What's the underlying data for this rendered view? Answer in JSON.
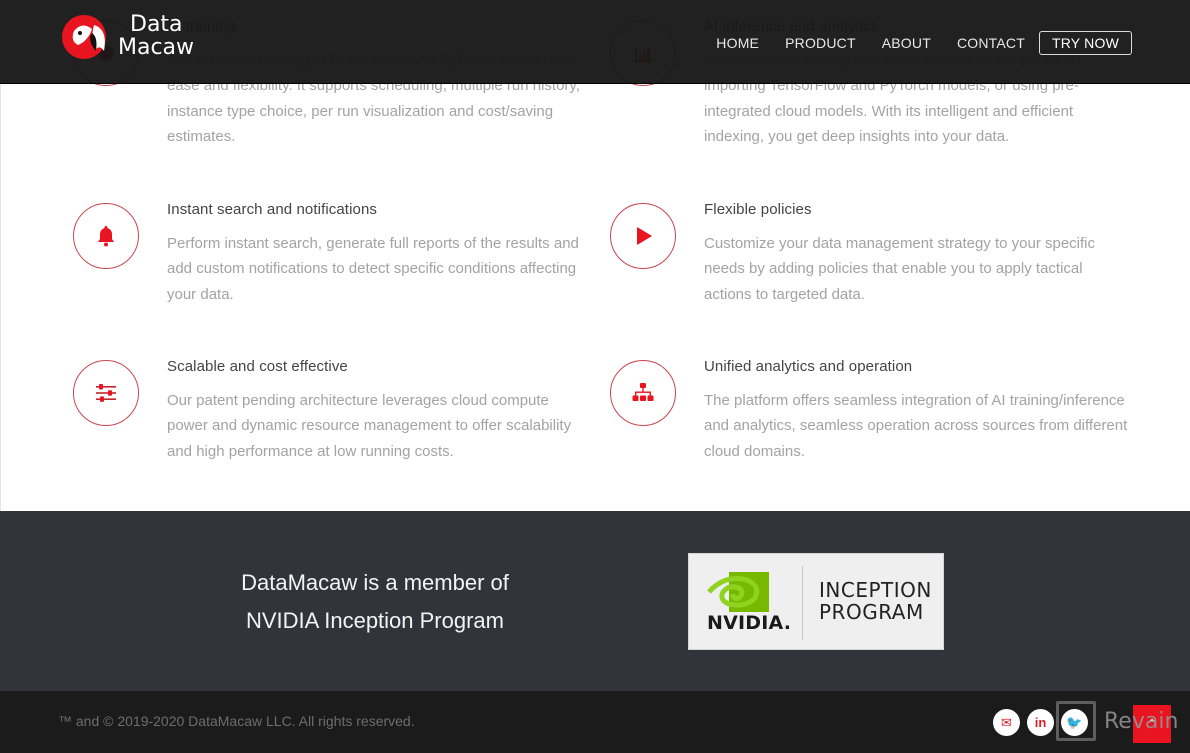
{
  "header": {
    "logo": {
      "line1": "Data",
      "line2": "Macaw"
    },
    "nav": [
      {
        "label": "HOME"
      },
      {
        "label": "PRODUCT"
      },
      {
        "label": "ABOUT"
      },
      {
        "label": "CONTACT"
      },
      {
        "label": "TRY NOW"
      }
    ]
  },
  "features": [
    {
      "title": "AI training",
      "description": "Scarlet offers training of TensorFlow and PyTorch models with ease and flexibility. It supports scheduling, multiple run history, instance type choice, per run visualization and cost/saving estimates.",
      "icon": "brain-icon"
    },
    {
      "title": "AI inference and analytics",
      "description": "Scarlet allows running AI models trained on the platform, importing TensorFlow and PyTorch models, or using pre-integrated cloud models. With its intelligent and efficient indexing, you get deep insights into your data.",
      "icon": "bar-chart-icon"
    },
    {
      "title": "Instant search and notifications",
      "description": "Perform instant search, generate full reports of the results and add custom notifications to detect specific conditions affecting your data.",
      "icon": "bell-icon"
    },
    {
      "title": "Flexible policies",
      "description": "Customize your data management strategy to your specific needs by adding policies that enable you to apply tactical actions to targeted data.",
      "icon": "play-icon"
    },
    {
      "title": "Scalable and cost effective",
      "description": "Our patent pending architecture leverages cloud compute power and dynamic resource management to offer scalability and high performance at low running costs.",
      "icon": "sliders-icon"
    },
    {
      "title": "Unified analytics and operation",
      "description": "The platform offers seamless integration of AI training/inference and analytics, seamless operation across sources from different cloud domains.",
      "icon": "sitemap-icon"
    }
  ],
  "nvidia": {
    "line1": "DataMacaw is a member of",
    "line2": "NVIDIA Inception Program",
    "badge_brand": "NVIDIA.",
    "badge_line1": "INCEPTION",
    "badge_line2": "PROGRAM"
  },
  "footer": {
    "copyright": "™ and © 2019-2020 DataMacaw LLC. All rights reserved.",
    "socials": [
      {
        "icon": "email-icon",
        "glyph": "✉"
      },
      {
        "icon": "linkedin-icon",
        "glyph": "in"
      },
      {
        "icon": "twitter-icon",
        "glyph": "🐦"
      }
    ],
    "watermark": "Revain",
    "back_to_top_glyph": "⌃"
  },
  "colors": {
    "accent": "#e8141f",
    "header_bg": "#181818",
    "band_bg": "#31353b",
    "footer_bg": "#1b1b1b"
  }
}
